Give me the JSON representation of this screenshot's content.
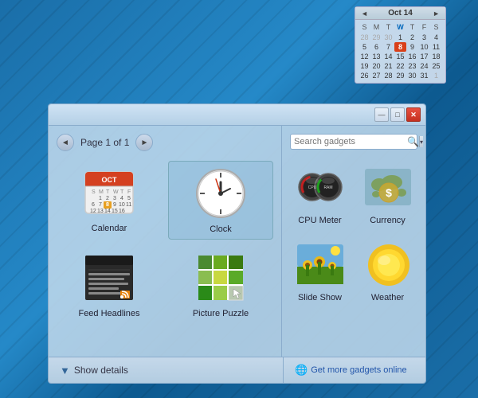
{
  "desktop": {
    "background_color": "#1a6ea8"
  },
  "calendar_widget": {
    "month": "Oct 14",
    "nav_prev": "◄",
    "nav_next": "►",
    "days_of_week": [
      "S",
      "M",
      "T",
      "W",
      "T",
      "F",
      "S"
    ],
    "weeks": [
      [
        {
          "day": "28",
          "other": true
        },
        {
          "day": "29",
          "other": true
        },
        {
          "day": "30",
          "other": true
        },
        {
          "day": "1",
          "other": false
        },
        {
          "day": "2",
          "other": false
        },
        {
          "day": "3",
          "other": false
        },
        {
          "day": "4",
          "other": false
        }
      ],
      [
        {
          "day": "5",
          "other": false
        },
        {
          "day": "6",
          "other": false
        },
        {
          "day": "7",
          "other": false
        },
        {
          "day": "8",
          "today": true
        },
        {
          "day": "9",
          "other": false
        },
        {
          "day": "10",
          "other": false
        },
        {
          "day": "11",
          "other": false
        }
      ],
      [
        {
          "day": "12",
          "other": false
        },
        {
          "day": "13",
          "other": false
        },
        {
          "day": "14",
          "other": false
        },
        {
          "day": "15",
          "other": false
        },
        {
          "day": "16",
          "other": false
        },
        {
          "day": "17",
          "other": false
        },
        {
          "day": "18",
          "other": false
        }
      ],
      [
        {
          "day": "19",
          "other": false
        },
        {
          "day": "20",
          "other": false
        },
        {
          "day": "21",
          "other": false
        },
        {
          "day": "22",
          "other": false
        },
        {
          "day": "23",
          "other": false
        },
        {
          "day": "24",
          "other": false
        },
        {
          "day": "25",
          "other": false
        }
      ],
      [
        {
          "day": "26",
          "other": false
        },
        {
          "day": "27",
          "other": false
        },
        {
          "day": "28",
          "other": false
        },
        {
          "day": "29",
          "other": false
        },
        {
          "day": "30",
          "other": false
        },
        {
          "day": "31",
          "other": false
        },
        {
          "day": "1",
          "other": true
        }
      ]
    ]
  },
  "gadget_gallery": {
    "title_bar": {
      "minimize_label": "—",
      "maximize_label": "□",
      "close_label": "✕"
    },
    "nav": {
      "prev_label": "◄",
      "next_label": "►",
      "page_label": "Page 1 of 1"
    },
    "search": {
      "placeholder": "Search gadgets",
      "icon": "🔍"
    },
    "gadgets_left": [
      {
        "name": "calendar",
        "label": "Calendar"
      },
      {
        "name": "clock",
        "label": "Clock"
      },
      {
        "name": "feedheadlines",
        "label": "Feed Headlines"
      },
      {
        "name": "picturepuzzle",
        "label": "Picture Puzzle"
      }
    ],
    "gadgets_right": [
      {
        "name": "cpumeter",
        "label": "CPU Meter"
      },
      {
        "name": "currency",
        "label": "Currency"
      },
      {
        "name": "slideshow",
        "label": "Slide Show"
      },
      {
        "name": "weather",
        "label": "Weather"
      }
    ],
    "footer": {
      "show_details_label": "Show details",
      "show_details_icon": "▼",
      "get_more_label": "Get more gadgets online",
      "get_more_icon": "🌐"
    }
  }
}
